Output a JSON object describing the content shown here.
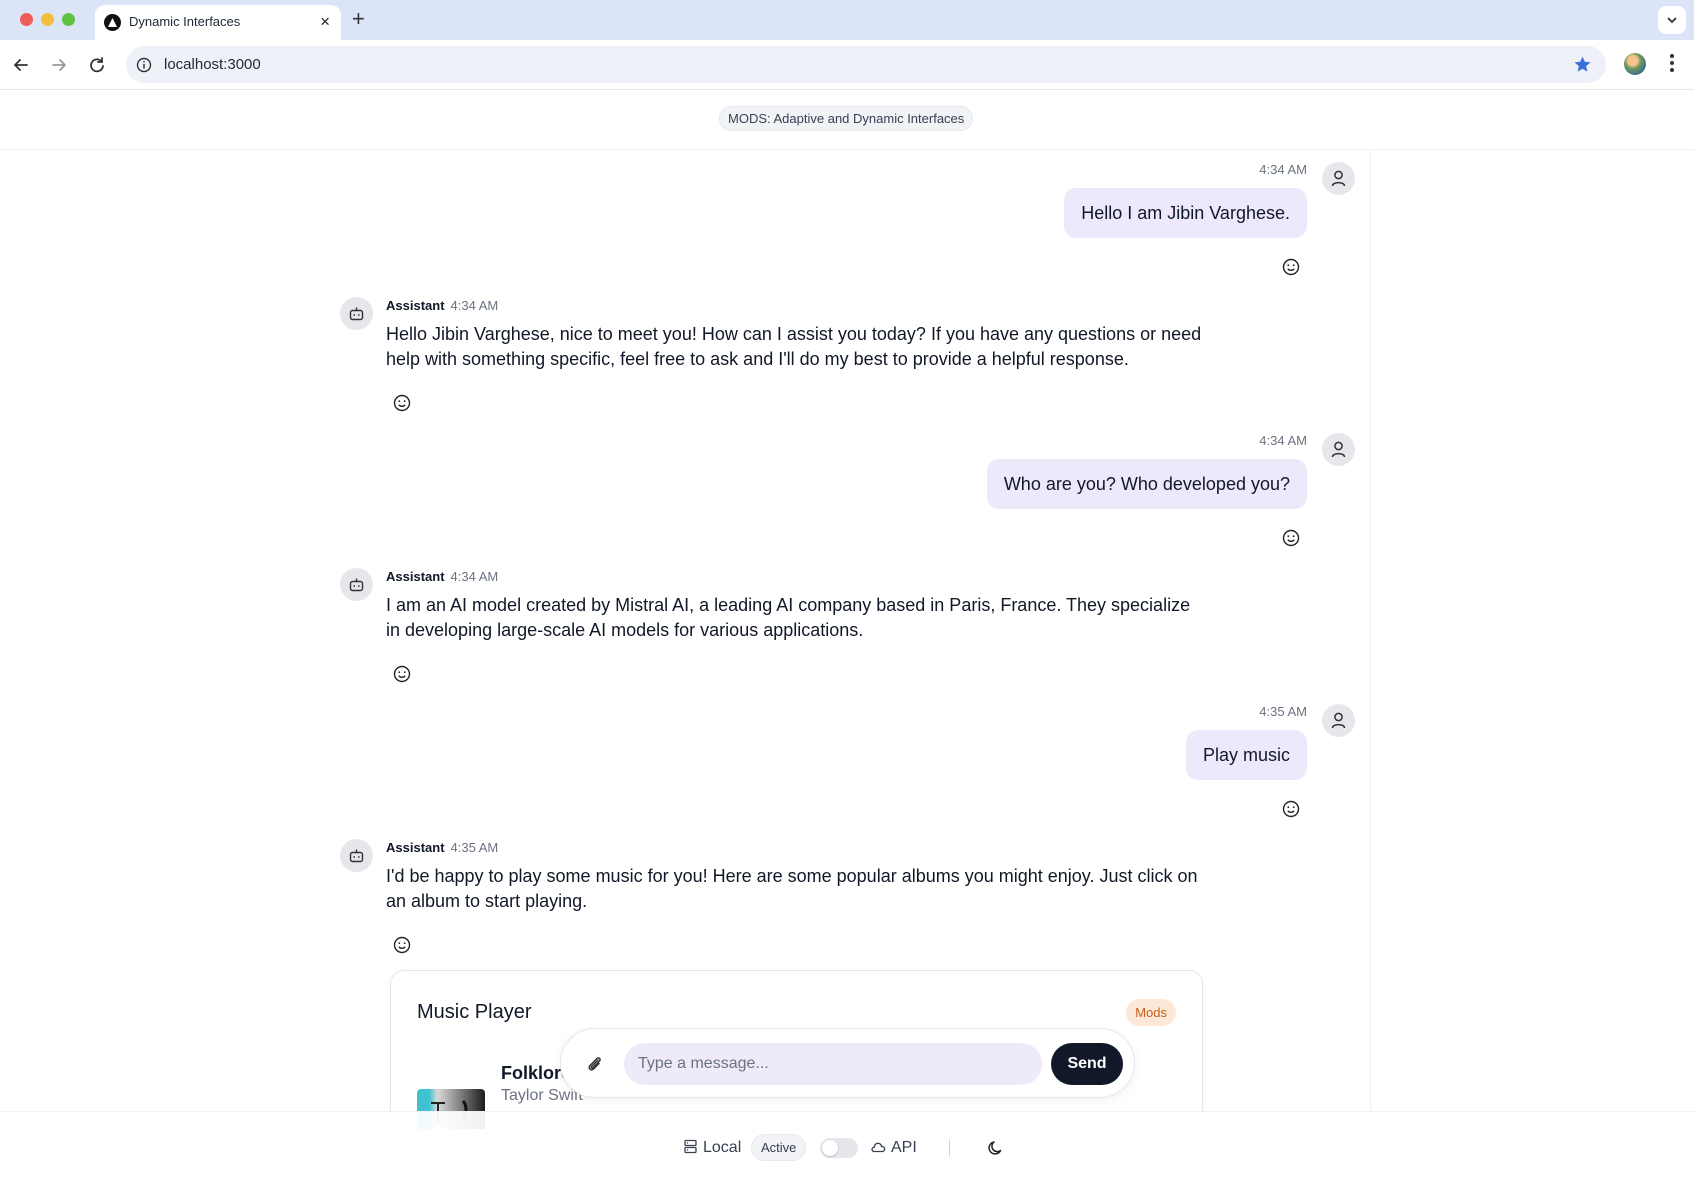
{
  "browser": {
    "tab_title": "Dynamic Interfaces",
    "url": "localhost:3000"
  },
  "app": {
    "header_badge": "MODS: Adaptive and Dynamic Interfaces"
  },
  "messages": [
    {
      "role": "user",
      "time": "4:34 AM",
      "text": "Hello I am Jibin Varghese."
    },
    {
      "role": "assistant",
      "name": "Assistant",
      "time": "4:34 AM",
      "text": "Hello Jibin Varghese, nice to meet you! How can I assist you today? If you have any questions or need help with something specific, feel free to ask and I'll do my best to provide a helpful response."
    },
    {
      "role": "user",
      "time": "4:34 AM",
      "text": "Who are you? Who developed you?"
    },
    {
      "role": "assistant",
      "name": "Assistant",
      "time": "4:34 AM",
      "text": "I am an AI model created by Mistral AI, a leading AI company based in Paris, France. They specialize in developing large-scale AI models for various applications."
    },
    {
      "role": "user",
      "time": "4:35 AM",
      "text": "Play music"
    },
    {
      "role": "assistant",
      "name": "Assistant",
      "time": "4:35 AM",
      "text": "I'd be happy to play some music for you! Here are some popular albums you might enjoy. Just click on an album to start playing."
    }
  ],
  "music_player": {
    "title": "Music Player",
    "badge": "Mods",
    "albums": [
      {
        "name": "Folklore",
        "artist": "Taylor Swift"
      }
    ]
  },
  "composer": {
    "placeholder": "Type a message...",
    "send_label": "Send"
  },
  "footer": {
    "local_label": "Local",
    "active_label": "Active",
    "api_label": "API"
  },
  "colors": {
    "user_bubble": "#ede9fb",
    "send_button": "#111827",
    "mods_badge_bg": "#fde8d8",
    "mods_badge_text": "#c2601b",
    "bookmark_star": "#3b6fd8"
  }
}
